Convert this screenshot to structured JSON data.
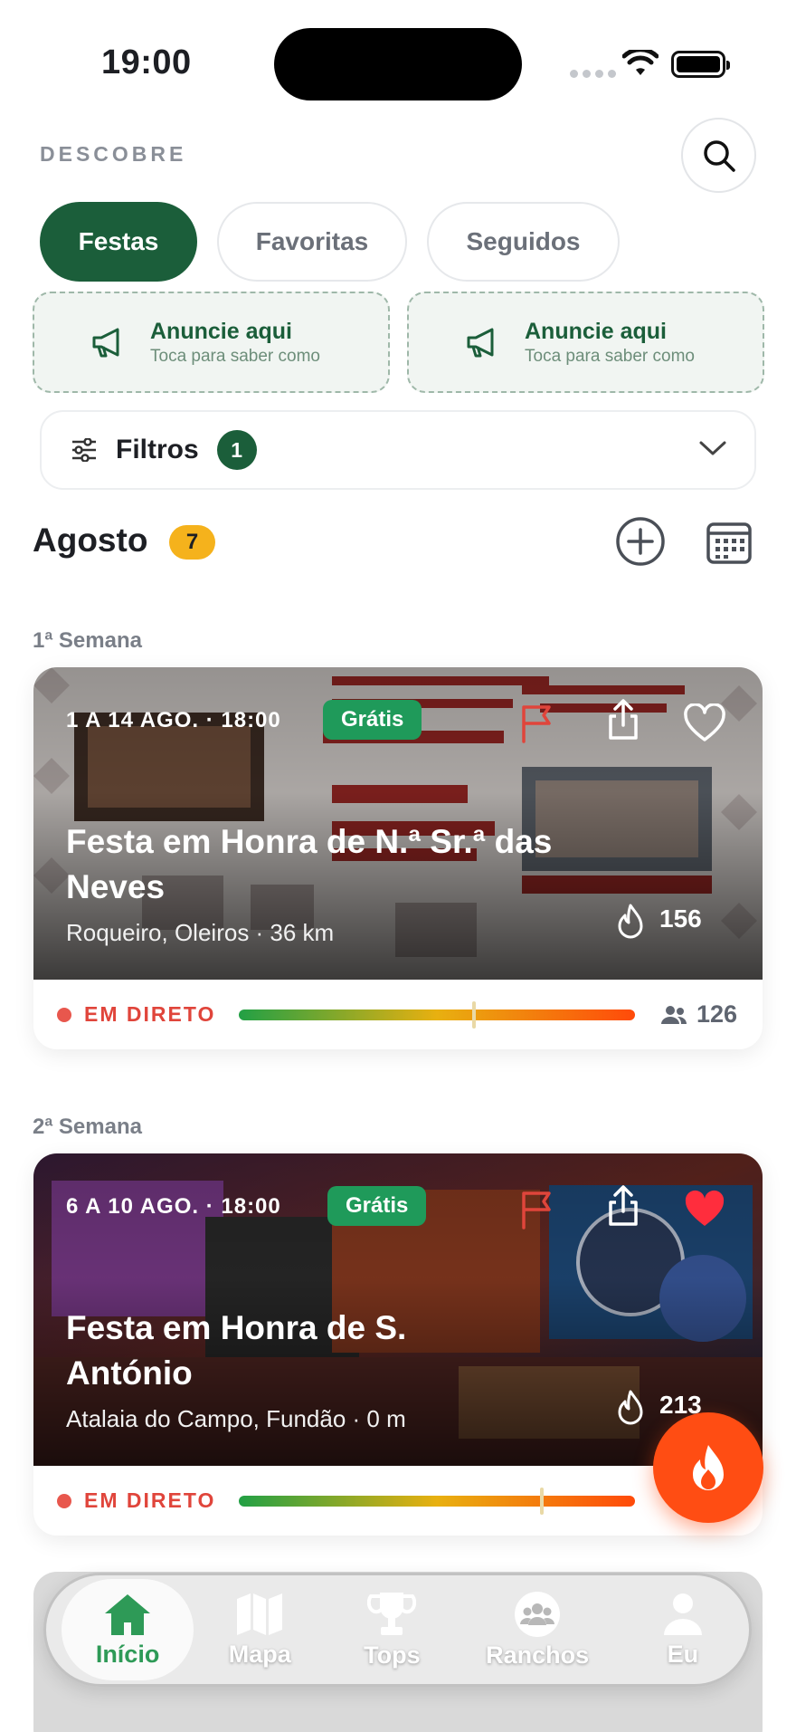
{
  "status_bar": {
    "time": "19:00"
  },
  "header": {
    "label": "DESCOBRE"
  },
  "tabs": [
    {
      "label": "Festas",
      "active": true
    },
    {
      "label": "Favoritas",
      "active": false
    },
    {
      "label": "Seguidos",
      "active": false
    }
  ],
  "ads": [
    {
      "title": "Anuncie aqui",
      "subtitle": "Toca para saber como"
    },
    {
      "title": "Anuncie aqui",
      "subtitle": "Toca para saber como"
    }
  ],
  "filters": {
    "label": "Filtros",
    "count": "1"
  },
  "month": {
    "name": "Agosto",
    "count": "7"
  },
  "weeks": [
    {
      "label": "1ª Semana",
      "event": {
        "date": "1 A 14 AGO. · 18:00",
        "price_badge": "Grátis",
        "title": "Festa em Honra de N.ª Sr.ª das Neves",
        "place": "Roqueiro, Oleiros · 36 km",
        "fire_count": "156",
        "live_label": "EM DIRETO",
        "heat_level": 0.59,
        "people_count": "126",
        "favorite": false
      }
    },
    {
      "label": "2ª Semana",
      "event": {
        "date": "6 A 10 AGO. · 18:00",
        "price_badge": "Grátis",
        "title": "Festa em Honra de S. António",
        "place": "Atalaia do Campo, Fundão · 0 m",
        "fire_count": "213",
        "live_label": "EM DIRETO",
        "heat_level": 0.76,
        "favorite": true
      }
    }
  ],
  "nav": [
    {
      "label": "Início",
      "icon": "home-icon",
      "active": true
    },
    {
      "label": "Mapa",
      "icon": "map-icon",
      "active": false
    },
    {
      "label": "Tops",
      "icon": "trophy-icon",
      "active": false
    },
    {
      "label": "Ranchos",
      "icon": "group-icon",
      "active": false
    },
    {
      "label": "Eu",
      "icon": "person-icon",
      "active": false
    }
  ],
  "colors": {
    "brand_green": "#1b5e3a",
    "free_green": "#1f9a5a",
    "live_red": "#e0453b",
    "fire_orange": "#ff4d13",
    "month_badge": "#f5b21c"
  }
}
